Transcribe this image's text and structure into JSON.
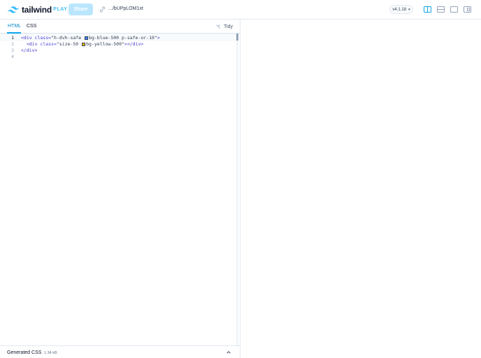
{
  "header": {
    "logo_text": "tailwind",
    "logo_badge": "PLAY",
    "share_label": "Share",
    "share_url": ".../bUPpLOM1xt",
    "version": "v4.1.18",
    "layout_icons": [
      "split-vertical-icon",
      "split-horizontal-icon",
      "editor-only-icon",
      "preview-only-icon"
    ],
    "accent_color": "#0ea5e9"
  },
  "editor": {
    "tabs": [
      {
        "label": "HTML",
        "active": true
      },
      {
        "label": "CSS",
        "active": false
      }
    ],
    "tidy_label": "Tidy",
    "line_numbers": [
      "1",
      "2",
      "3",
      "4"
    ],
    "lines": [
      {
        "open_tag": "<div",
        "attr": " class=",
        "value_pre": "\"h-dvh-safe ",
        "swatch_color": "#3b82f6",
        "value_post": "bg-blue-500 p-safe-or-10\"",
        "close": ">"
      },
      {
        "indent": "  ",
        "open_tag": "<div",
        "attr": " class=",
        "value_pre": "\"size-50 ",
        "swatch_color": "#eab308",
        "value_post": "bg-yellow-500\"",
        "close": "></div>"
      },
      {
        "text": "</div>"
      },
      {
        "text": ""
      }
    ]
  },
  "footer": {
    "title": "Generated CSS",
    "size": "1.34 kB"
  }
}
